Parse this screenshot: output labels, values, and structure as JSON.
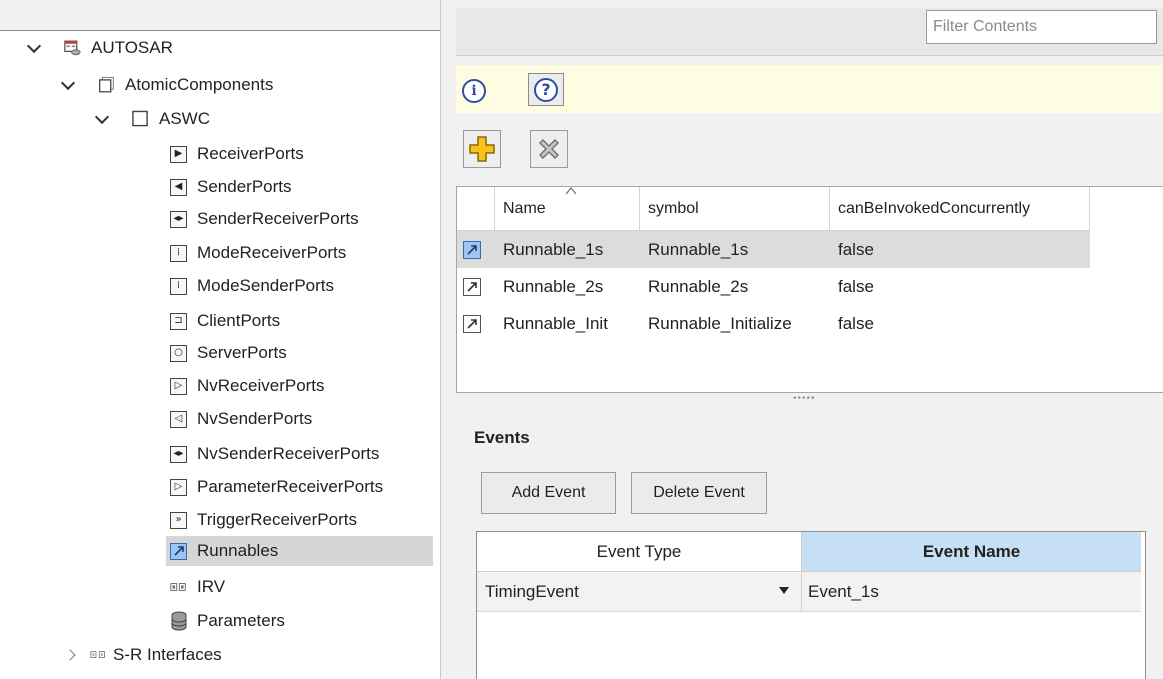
{
  "tree": {
    "root": "AUTOSAR",
    "atomic": "AtomicComponents",
    "component": "ASWC",
    "items": [
      {
        "label": "ReceiverPorts",
        "icon": "receiver-port-icon",
        "glyph": "▶"
      },
      {
        "label": "SenderPorts",
        "icon": "sender-port-icon",
        "glyph": "◀"
      },
      {
        "label": "SenderReceiverPorts",
        "icon": "sender-receiver-port-icon",
        "glyph": "◂▸"
      },
      {
        "label": "ModeReceiverPorts",
        "icon": "mode-receiver-port-icon",
        "glyph": "⁞"
      },
      {
        "label": "ModeSenderPorts",
        "icon": "mode-sender-port-icon",
        "glyph": "⁞"
      },
      {
        "label": "ClientPorts",
        "icon": "client-port-icon",
        "glyph": "⊐"
      },
      {
        "label": "ServerPorts",
        "icon": "server-port-icon",
        "glyph": "○"
      },
      {
        "label": "NvReceiverPorts",
        "icon": "nv-receiver-port-icon",
        "glyph": "▷"
      },
      {
        "label": "NvSenderPorts",
        "icon": "nv-sender-port-icon",
        "glyph": "◁"
      },
      {
        "label": "NvSenderReceiverPorts",
        "icon": "nv-sender-receiver-port-icon",
        "glyph": "◂▸"
      },
      {
        "label": "ParameterReceiverPorts",
        "icon": "parameter-receiver-port-icon",
        "glyph": "▷"
      },
      {
        "label": "TriggerReceiverPorts",
        "icon": "trigger-receiver-port-icon",
        "glyph": "»"
      },
      {
        "label": "Runnables",
        "icon": "runnable-icon",
        "glyph": "↗"
      },
      {
        "label": "IRV",
        "icon": "irv-icon",
        "glyph": "▫▫"
      },
      {
        "label": "Parameters",
        "icon": "parameters-database-icon",
        "glyph": "≣"
      }
    ],
    "interfaces": "S-R Interfaces"
  },
  "filter": {
    "placeholder": "Filter Contents"
  },
  "runnables": {
    "columns": [
      "Name",
      "symbol",
      "canBeInvokedConcurrently"
    ],
    "rows": [
      {
        "name": "Runnable_1s",
        "symbol": "Runnable_1s",
        "concurrent": "false"
      },
      {
        "name": "Runnable_2s",
        "symbol": "Runnable_2s",
        "concurrent": "false"
      },
      {
        "name": "Runnable_Init",
        "symbol": "Runnable_Initialize",
        "concurrent": "false"
      }
    ]
  },
  "events": {
    "title": "Events",
    "add_label": "Add Event",
    "delete_label": "Delete Event",
    "columns": [
      "Event Type",
      "Event Name"
    ],
    "rows": [
      {
        "type": "TimingEvent",
        "name": "Event_1s"
      }
    ]
  },
  "colors": {
    "info_bar": "#fefde1",
    "header_selected": "#c6dff5",
    "row_selected": "#dcdcdc",
    "add_icon": "#f5b800"
  }
}
